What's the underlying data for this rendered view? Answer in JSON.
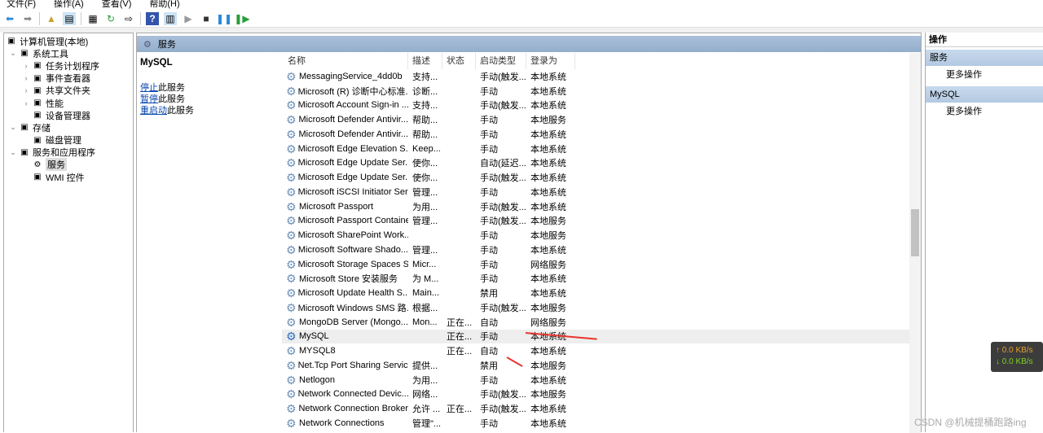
{
  "menu": [
    "文件(F)",
    "操作(A)",
    "查看(V)",
    "帮助(H)"
  ],
  "tree": [
    {
      "label": "计算机管理(本地)",
      "level": 0,
      "expander": "",
      "icon": "computer-icon"
    },
    {
      "label": "系统工具",
      "level": 1,
      "expander": "⌄",
      "icon": "tools-icon"
    },
    {
      "label": "任务计划程序",
      "level": 2,
      "expander": "›",
      "icon": "clock-icon"
    },
    {
      "label": "事件查看器",
      "level": 2,
      "expander": "›",
      "icon": "event-viewer-icon"
    },
    {
      "label": "共享文件夹",
      "level": 2,
      "expander": "›",
      "icon": "shared-folder-icon"
    },
    {
      "label": "性能",
      "level": 2,
      "expander": "›",
      "icon": "performance-icon"
    },
    {
      "label": "设备管理器",
      "level": 2,
      "expander": "",
      "icon": "device-manager-icon"
    },
    {
      "label": "存储",
      "level": 1,
      "expander": "⌄",
      "icon": "storage-icon"
    },
    {
      "label": "磁盘管理",
      "level": 2,
      "expander": "",
      "icon": "disk-icon"
    },
    {
      "label": "服务和应用程序",
      "level": 1,
      "expander": "⌄",
      "icon": "services-apps-icon"
    },
    {
      "label": "服务",
      "level": 2,
      "expander": "",
      "icon": "gear-icon",
      "selected": true
    },
    {
      "label": "WMI 控件",
      "level": 2,
      "expander": "",
      "icon": "wmi-icon"
    }
  ],
  "header": {
    "title": "服务"
  },
  "detail": {
    "title": "MySQL",
    "actions": [
      {
        "link": "停止",
        "rest": "此服务"
      },
      {
        "link": "暂停",
        "rest": "此服务"
      },
      {
        "link": "重启动",
        "rest": "此服务"
      }
    ]
  },
  "columns": [
    "名称",
    "描述",
    "状态",
    "启动类型",
    "登录为"
  ],
  "services": [
    [
      "MessagingService_4dd0b",
      "支持...",
      "",
      "手动(触发...",
      "本地系统"
    ],
    [
      "Microsoft (R) 诊断中心标准...",
      "诊断...",
      "",
      "手动",
      "本地系统"
    ],
    [
      "Microsoft Account Sign-in ...",
      "支持...",
      "",
      "手动(触发...",
      "本地系统"
    ],
    [
      "Microsoft Defender Antivir...",
      "帮助...",
      "",
      "手动",
      "本地服务"
    ],
    [
      "Microsoft Defender Antivir...",
      "帮助...",
      "",
      "手动",
      "本地系统"
    ],
    [
      "Microsoft Edge Elevation S...",
      "Keep...",
      "",
      "手动",
      "本地系统"
    ],
    [
      "Microsoft Edge Update Ser...",
      "使你...",
      "",
      "自动(延迟...",
      "本地系统"
    ],
    [
      "Microsoft Edge Update Ser...",
      "使你...",
      "",
      "手动(触发...",
      "本地系统"
    ],
    [
      "Microsoft iSCSI Initiator Ser...",
      "管理...",
      "",
      "手动",
      "本地系统"
    ],
    [
      "Microsoft Passport",
      "为用...",
      "",
      "手动(触发...",
      "本地系统"
    ],
    [
      "Microsoft Passport Container",
      "管理...",
      "",
      "手动(触发...",
      "本地服务"
    ],
    [
      "Microsoft SharePoint Work...",
      "",
      "",
      "手动",
      "本地服务"
    ],
    [
      "Microsoft Software Shado...",
      "管理...",
      "",
      "手动",
      "本地系统"
    ],
    [
      "Microsoft Storage Spaces S...",
      "Micr...",
      "",
      "手动",
      "网络服务"
    ],
    [
      "Microsoft Store 安装服务",
      "为 M...",
      "",
      "手动",
      "本地系统"
    ],
    [
      "Microsoft Update Health S...",
      "Main...",
      "",
      "禁用",
      "本地系统"
    ],
    [
      "Microsoft Windows SMS 路...",
      "根据...",
      "",
      "手动(触发...",
      "本地服务"
    ],
    [
      "MongoDB Server (Mongo...",
      "Mon...",
      "正在...",
      "自动",
      "网络服务"
    ],
    [
      "MySQL",
      "",
      "正在...",
      "手动",
      "本地系统"
    ],
    [
      "MYSQL8",
      "",
      "正在...",
      "自动",
      "本地系统"
    ],
    [
      "Net.Tcp Port Sharing Service",
      "提供...",
      "",
      "禁用",
      "本地服务"
    ],
    [
      "Netlogon",
      "为用...",
      "",
      "手动",
      "本地系统"
    ],
    [
      "Network Connected Devic...",
      "网络...",
      "",
      "手动(触发...",
      "本地服务"
    ],
    [
      "Network Connection Broker",
      "允许 ...",
      "正在...",
      "手动(触发...",
      "本地系统"
    ],
    [
      "Network Connections",
      "管理\"...",
      "",
      "手动",
      "本地系统"
    ]
  ],
  "selected_service": "MySQL",
  "actions": {
    "title": "操作",
    "sections": [
      {
        "label": "服务",
        "more": "更多操作"
      },
      {
        "label": "MySQL",
        "more": "更多操作"
      }
    ]
  },
  "net": {
    "up": "0.0 KB/s",
    "down": "0.0 KB/s",
    "up_color": "#e0a030",
    "down_color": "#7ed321"
  },
  "watermark": "CSDN @机械提桶跑路ing",
  "colors": {
    "header": "#a9c0da",
    "annotation_arrow": "#e8352b"
  }
}
